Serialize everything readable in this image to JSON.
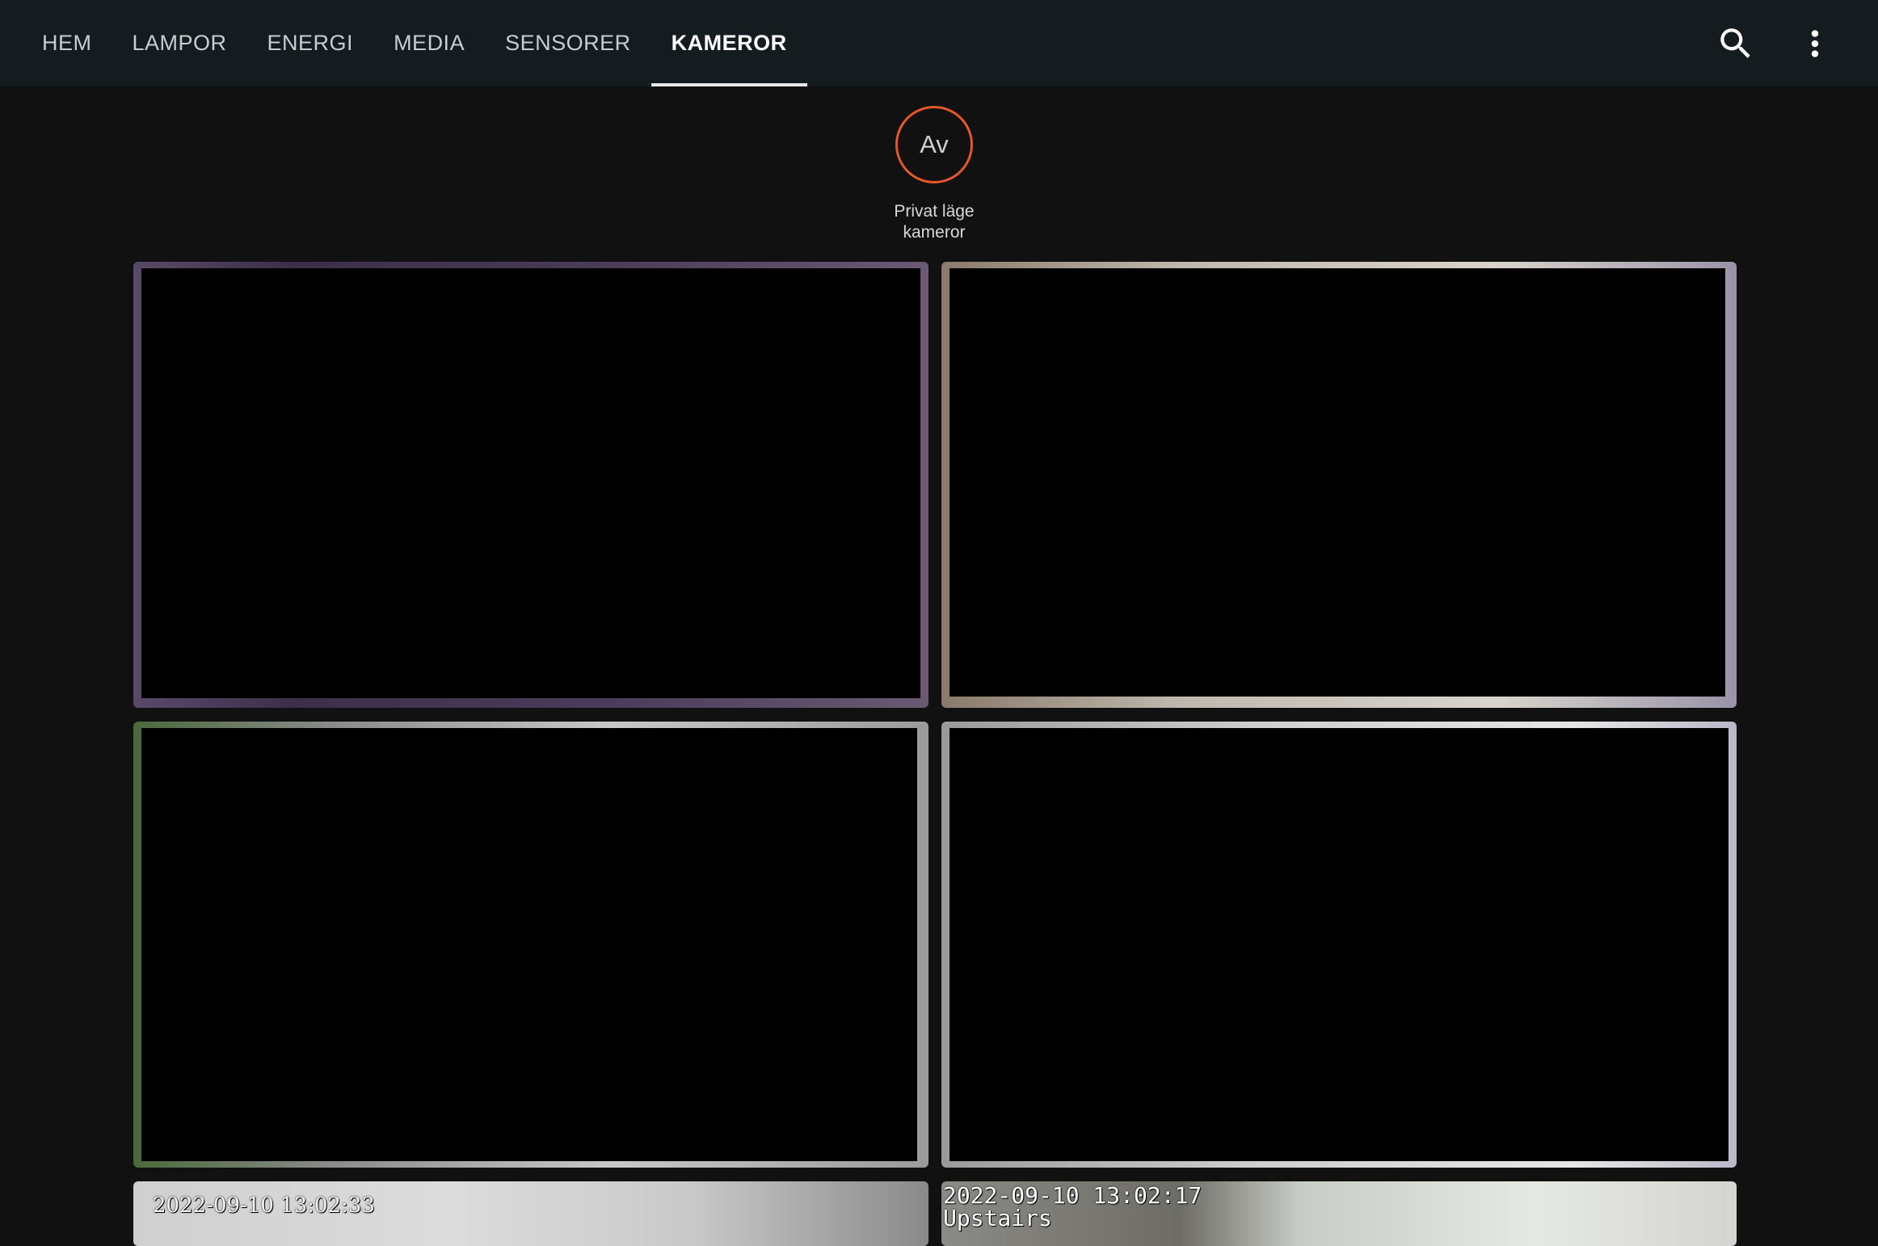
{
  "tabs": [
    {
      "label": "HEM"
    },
    {
      "label": "LAMPOR"
    },
    {
      "label": "ENERGI"
    },
    {
      "label": "MEDIA"
    },
    {
      "label": "SENSORER"
    },
    {
      "label": "KAMEROR"
    }
  ],
  "active_tab": "KAMEROR",
  "header_icons": [
    "search-icon",
    "more-vertical-icon"
  ],
  "privacy": {
    "state": "Av",
    "label_line1": "Privat läge",
    "label_line2": "kameror",
    "accent": "#e4582a"
  },
  "cameras": [
    {
      "timestamp": "",
      "name": ""
    },
    {
      "timestamp": "",
      "name": ""
    },
    {
      "timestamp": "",
      "name": ""
    },
    {
      "timestamp": "",
      "name": ""
    },
    {
      "timestamp": "2022-09-10 13:02:33",
      "name": ""
    },
    {
      "timestamp": "2022-09-10 13:02:17",
      "name": "Upstairs"
    }
  ],
  "colors": {
    "header_bg": "#141c20",
    "page_bg": "#111111",
    "active_tab_indicator": "#e8e8e8"
  }
}
